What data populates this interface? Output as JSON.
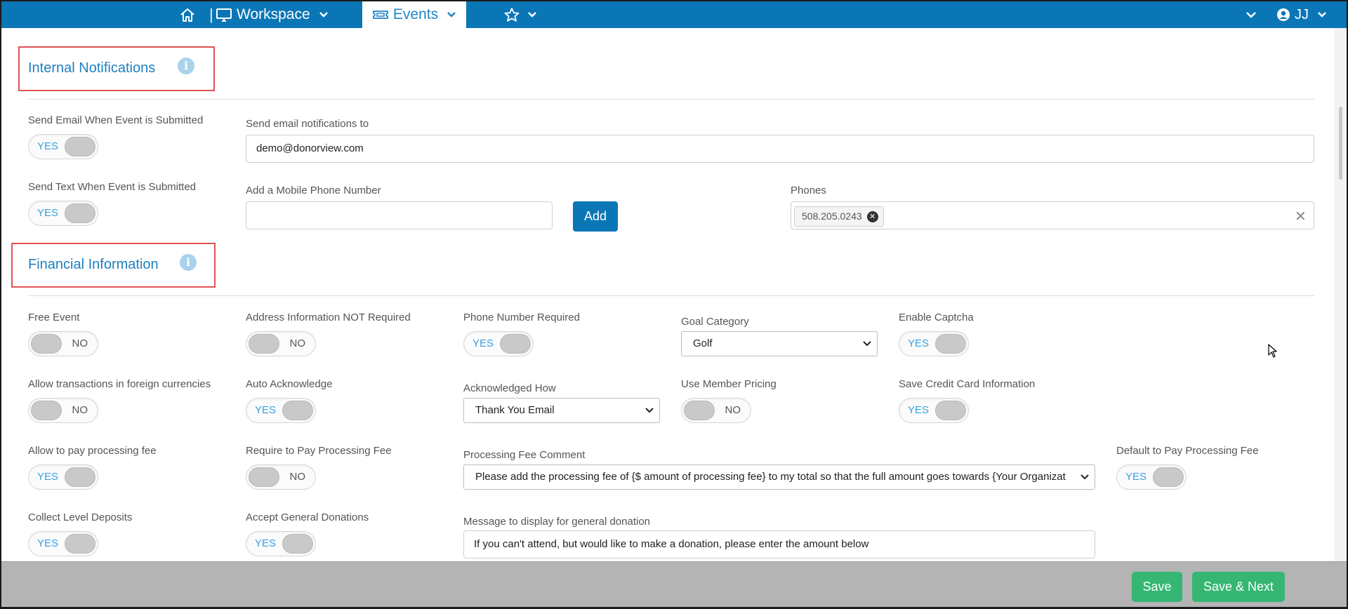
{
  "nav": {
    "workspace_label": "Workspace",
    "events_label": "Events",
    "separator": "|",
    "user_initials": "JJ",
    "colors": {
      "nav_bg": "#0b76b5",
      "accent": "#1f86c6"
    }
  },
  "internal_notifications": {
    "title": "Internal Notifications",
    "info_glyph": "i",
    "send_email_label": "Send Email When Event is Submitted",
    "send_email_toggle": "YES",
    "email_to_label": "Send email notifications to",
    "email_to_value": "demo@donorview.com",
    "send_text_label": "Send Text When Event is Submitted",
    "send_text_toggle": "YES",
    "mobile_label": "Add a Mobile Phone Number",
    "mobile_value": "",
    "add_button": "Add",
    "phones_label": "Phones",
    "phones": [
      "508.205.0243"
    ],
    "chip_remove_glyph": "✕",
    "clear_glyph": "✕"
  },
  "financial_information": {
    "title": "Financial Information",
    "info_glyph": "i",
    "free_event_label": "Free Event",
    "free_event_toggle": "NO",
    "address_label": "Address Information NOT Required",
    "address_toggle": "NO",
    "phone_required_label": "Phone Number Required",
    "phone_required_toggle": "YES",
    "goal_category_label": "Goal Category",
    "goal_category_value": "Golf",
    "captcha_label": "Enable Captcha",
    "captcha_toggle": "YES",
    "foreign_label": "Allow transactions in foreign currencies",
    "foreign_toggle": "NO",
    "auto_ack_label": "Auto Acknowledge",
    "auto_ack_toggle": "YES",
    "ack_how_label": "Acknowledged How",
    "ack_how_value": "Thank You Email",
    "member_pricing_label": "Use Member Pricing",
    "member_pricing_toggle": "NO",
    "save_cc_label": "Save Credit Card Information",
    "save_cc_toggle": "YES",
    "allow_fee_label": "Allow to pay processing fee",
    "allow_fee_toggle": "YES",
    "require_fee_label": "Require to Pay Processing Fee",
    "require_fee_toggle": "NO",
    "fee_comment_label": "Processing Fee Comment",
    "fee_comment_value": "Please add the processing fee of {$ amount of processing fee} to my total so that the full amount goes towards {Your Organizat",
    "default_fee_label": "Default to Pay Processing Fee",
    "default_fee_toggle": "YES",
    "level_deposits_label": "Collect Level Deposits",
    "level_deposits_toggle": "YES",
    "general_donations_label": "Accept General Donations",
    "general_donations_toggle": "YES",
    "general_message_label": "Message to display for general donation",
    "general_message_value": "If you can't attend, but would like to make a donation, please enter the amount below"
  },
  "footer": {
    "save_label": "Save",
    "save_next_label": "Save & Next",
    "button_color": "#35b673"
  }
}
